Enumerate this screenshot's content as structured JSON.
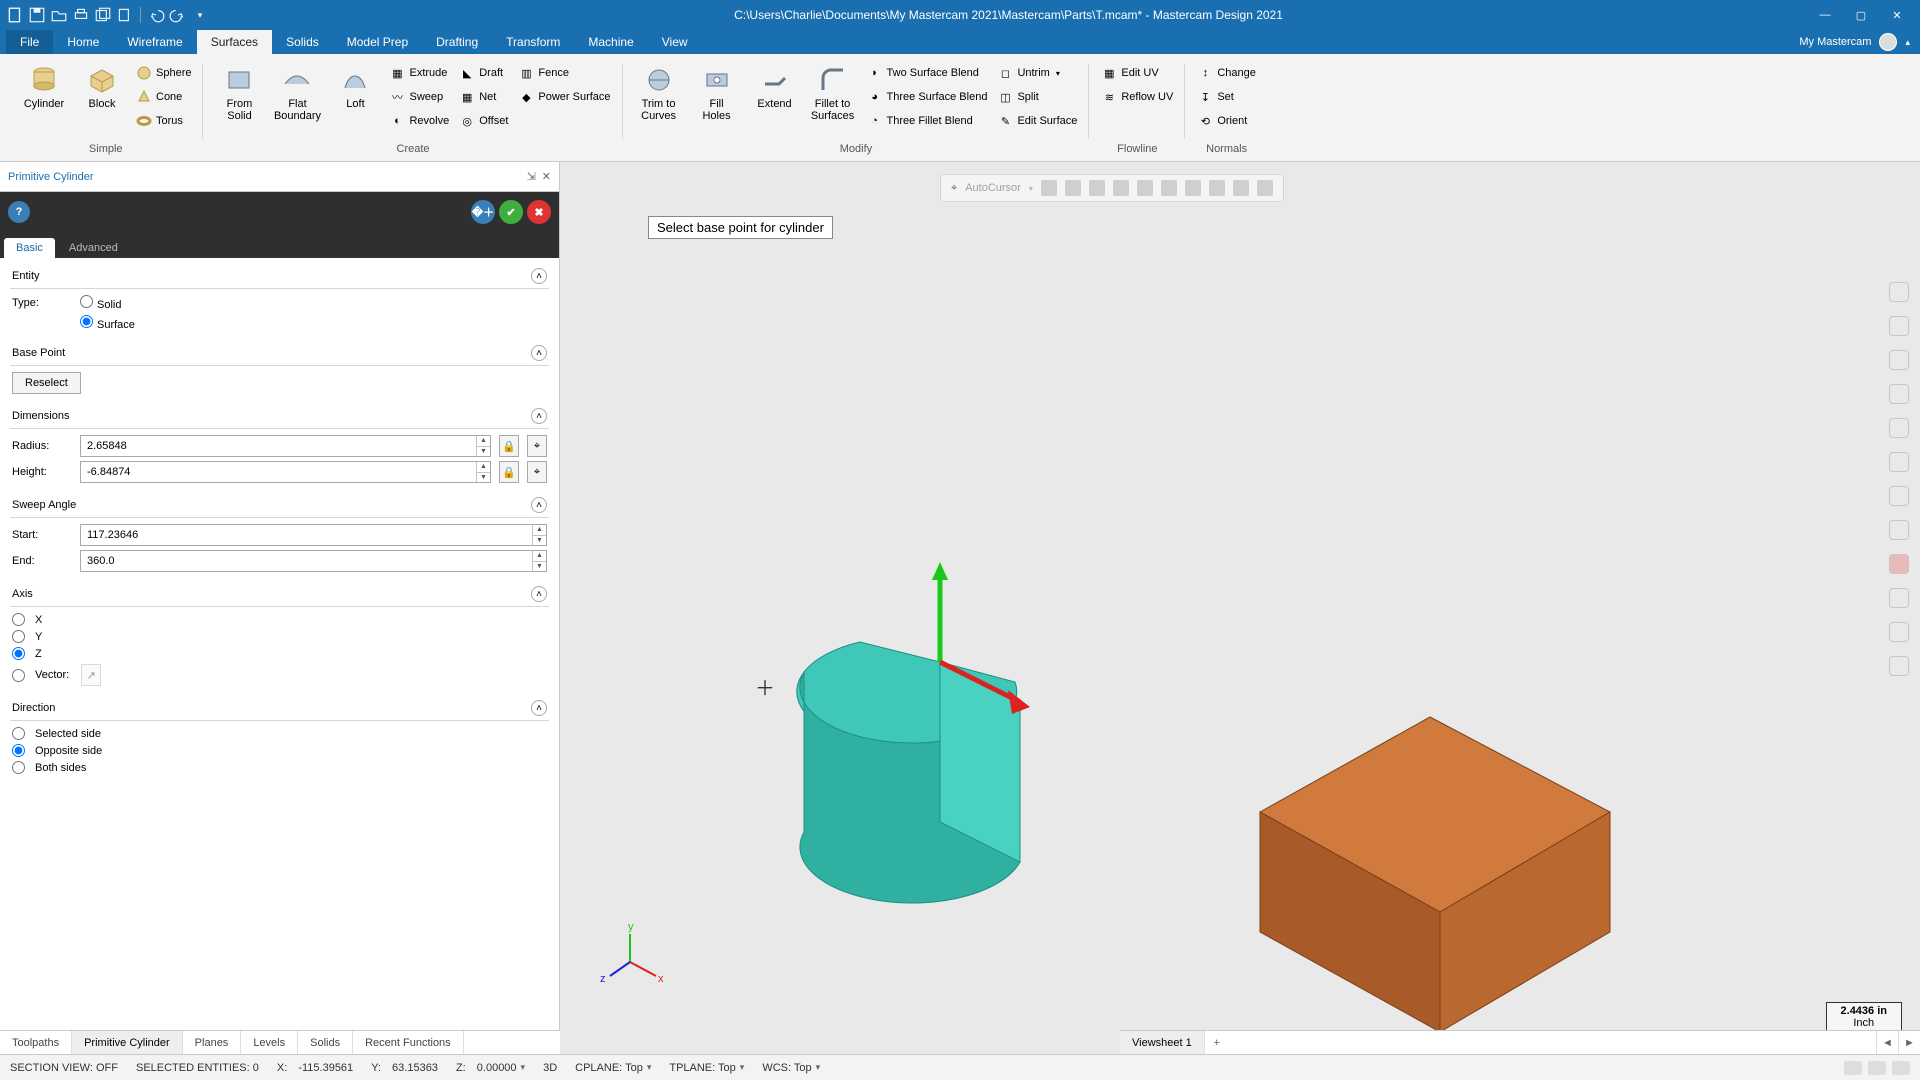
{
  "window": {
    "title": "C:\\Users\\Charlie\\Documents\\My Mastercam 2021\\Mastercam\\Parts\\T.mcam* - Mastercam Design 2021",
    "my_mastercam": "My Mastercam"
  },
  "tabs": {
    "file": "File",
    "list": [
      "Home",
      "Wireframe",
      "Surfaces",
      "Solids",
      "Model Prep",
      "Drafting",
      "Transform",
      "Machine",
      "View"
    ],
    "active": "Surfaces"
  },
  "ribbon": {
    "simple": {
      "label": "Simple",
      "cylinder": "Cylinder",
      "block": "Block",
      "sphere": "Sphere",
      "cone": "Cone",
      "torus": "Torus"
    },
    "create": {
      "label": "Create",
      "from_solid": "From\nSolid",
      "flat_boundary": "Flat\nBoundary",
      "loft": "Loft",
      "extrude": "Extrude",
      "sweep": "Sweep",
      "revolve": "Revolve",
      "draft": "Draft",
      "net": "Net",
      "offset": "Offset",
      "fence": "Fence",
      "power_surface": "Power Surface"
    },
    "modify": {
      "label": "Modify",
      "trim_to_curves": "Trim to\nCurves",
      "fill_holes": "Fill\nHoles",
      "extend": "Extend",
      "fillet_to_surfaces": "Fillet to\nSurfaces",
      "two_surface_blend": "Two Surface Blend",
      "three_surface_blend": "Three Surface Blend",
      "three_fillet_blend": "Three Fillet Blend",
      "untrim": "Untrim",
      "split": "Split",
      "edit_surface": "Edit Surface"
    },
    "flowline": {
      "label": "Flowline",
      "edit_uv": "Edit UV",
      "reflow_uv": "Reflow UV"
    },
    "normals": {
      "label": "Normals",
      "change": "Change",
      "set": "Set",
      "orient": "Orient"
    }
  },
  "panel": {
    "title": "Primitive Cylinder",
    "tabs": {
      "basic": "Basic",
      "advanced": "Advanced"
    },
    "entity": {
      "header": "Entity",
      "type_label": "Type:",
      "solid": "Solid",
      "surface": "Surface"
    },
    "base_point": {
      "header": "Base Point",
      "reselect": "Reselect"
    },
    "dimensions": {
      "header": "Dimensions",
      "radius_label": "Radius:",
      "radius_value": "2.65848",
      "height_label": "Height:",
      "height_value": "-6.84874"
    },
    "sweep": {
      "header": "Sweep Angle",
      "start_label": "Start:",
      "start_value": "117.23646",
      "end_label": "End:",
      "end_value": "360.0"
    },
    "axis": {
      "header": "Axis",
      "x": "X",
      "y": "Y",
      "z": "Z",
      "vector": "Vector:"
    },
    "direction": {
      "header": "Direction",
      "selected": "Selected side",
      "opposite": "Opposite side",
      "both": "Both sides"
    }
  },
  "viewport": {
    "hint": "Select base point for cylinder",
    "autocursor": "AutoCursor",
    "scale_value": "2.4436 in",
    "scale_unit": "Inch"
  },
  "bottom_tabs": {
    "left": [
      "Toolpaths",
      "Primitive Cylinder",
      "Planes",
      "Levels",
      "Solids",
      "Recent Functions"
    ],
    "left_active": "Primitive Cylinder",
    "viewsheet": "Viewsheet 1"
  },
  "status": {
    "section_view": "SECTION VIEW: OFF",
    "selected": "SELECTED ENTITIES: 0",
    "x_label": "X:",
    "x_val": "-115.39561",
    "y_label": "Y:",
    "y_val": "63.15363",
    "z_label": "Z:",
    "z_val": "0.00000",
    "mode": "3D",
    "cplane": "CPLANE: Top",
    "tplane": "TPLANE: Top",
    "wcs": "WCS: Top"
  }
}
